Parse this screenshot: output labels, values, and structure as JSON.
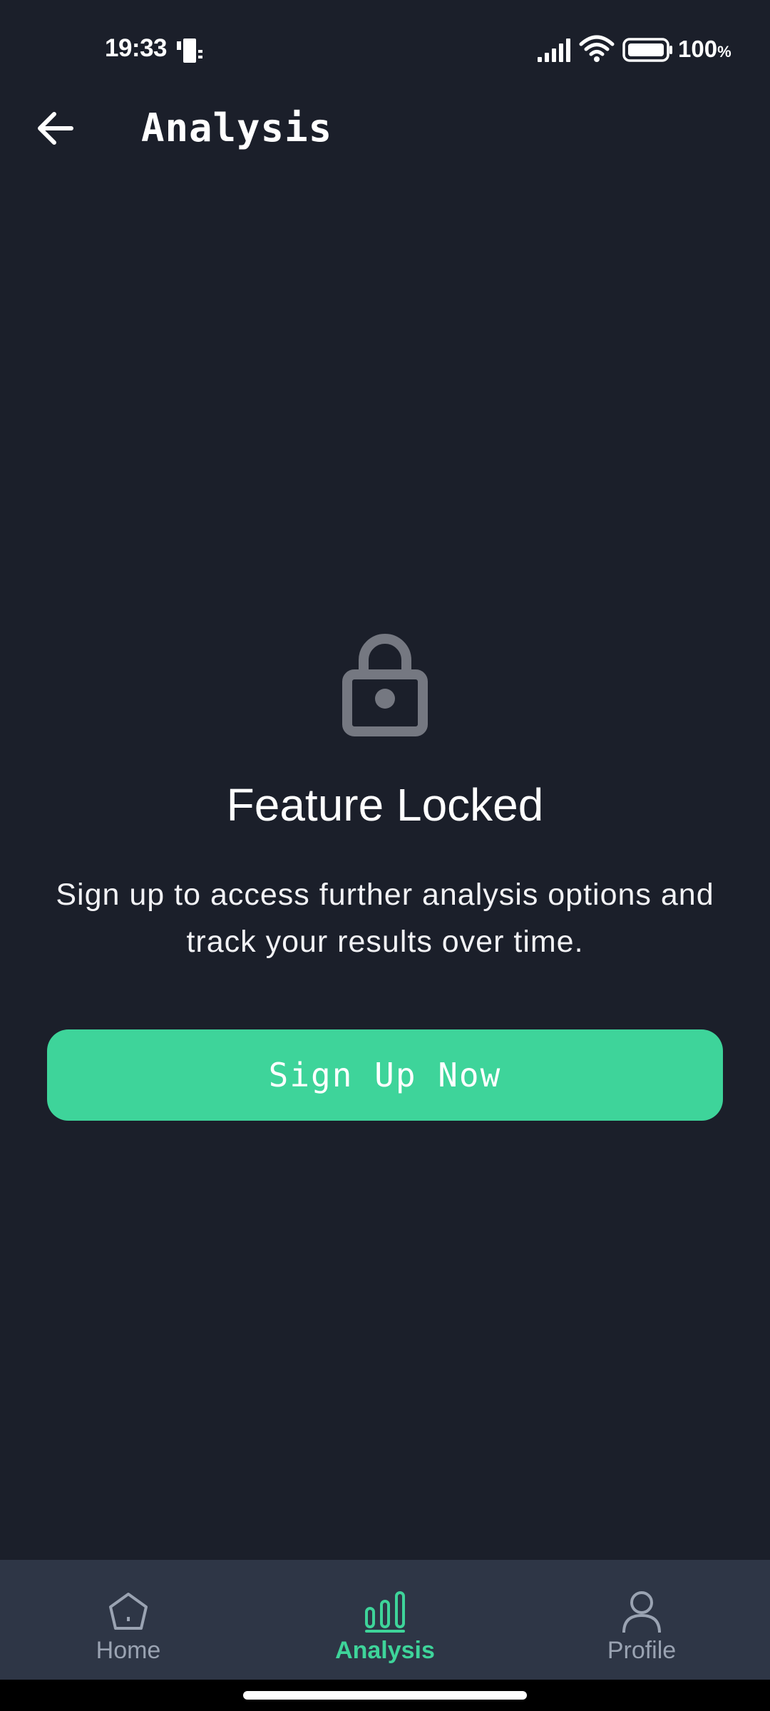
{
  "status_bar": {
    "time": "19:33",
    "battery": "100",
    "battery_unit": "%"
  },
  "app_bar": {
    "title": "Analysis",
    "back_icon": "arrow-left-icon"
  },
  "locked": {
    "icon": "lock-icon",
    "title": "Feature Locked",
    "description": "Sign up to access further analysis options and track your results over time.",
    "button_label": "Sign Up Now"
  },
  "bottom_nav": {
    "items": [
      {
        "label": "Home",
        "icon": "home-icon",
        "active": false
      },
      {
        "label": "Analysis",
        "icon": "bar-chart-icon",
        "active": true
      },
      {
        "label": "Profile",
        "icon": "person-icon",
        "active": false
      }
    ]
  },
  "colors": {
    "background": "#1b1f2a",
    "accent": "#3ed49a",
    "nav_background": "#2e3646",
    "lock_icon": "#757881",
    "inactive": "#9aa3b2"
  }
}
